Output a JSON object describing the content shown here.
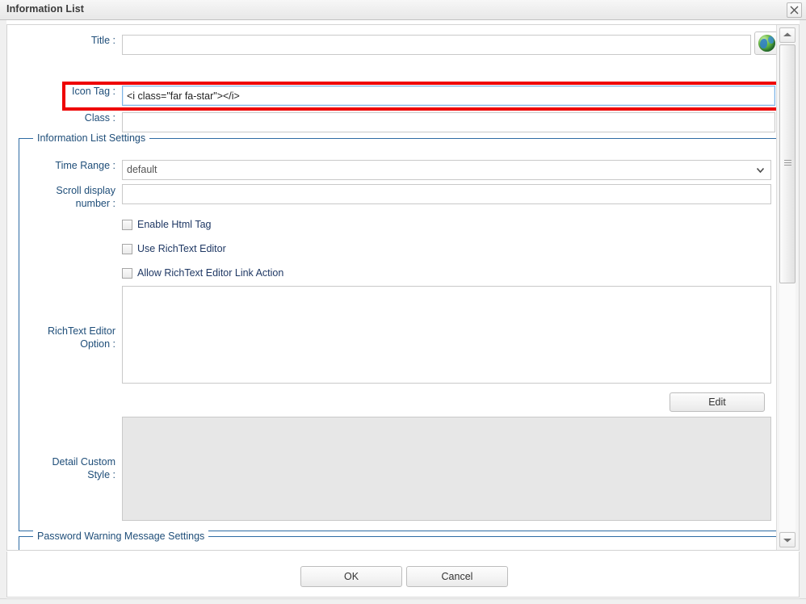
{
  "window": {
    "title": "Information List",
    "close_icon": "close-icon"
  },
  "form": {
    "title": {
      "label": "Title :",
      "value": "",
      "placeholder": ""
    },
    "icon_tag": {
      "label": "Icon Tag :",
      "value": "<i class=\"far fa-star\"></i>",
      "placeholder": "",
      "highlight_color": "#ee0000"
    },
    "class": {
      "label": "Class :",
      "value": "",
      "placeholder": ""
    },
    "globe_button": {
      "icon": "globe-icon"
    }
  },
  "settings_fieldset": {
    "legend": "Information List Settings",
    "time_range": {
      "label": "Time Range :",
      "selected": "default",
      "caret_icon": "chevron-down-icon"
    },
    "scroll_display_number": {
      "label": "Scroll display\nnumber :",
      "value": "",
      "placeholder": ""
    },
    "checkboxes": [
      {
        "label": "Enable Html Tag",
        "checked": false
      },
      {
        "label": "Use RichText Editor",
        "checked": false
      },
      {
        "label": "Allow RichText Editor Link Action",
        "checked": false
      }
    ],
    "richtext_editor_option": {
      "label": "RichText Editor\nOption :",
      "value": ""
    },
    "edit_button": {
      "label": "Edit"
    },
    "detail_custom_style": {
      "label": "Detail Custom\nStyle :",
      "value": "",
      "readonly": true
    }
  },
  "password_fieldset": {
    "legend": "Password Warning Message Settings"
  },
  "scrollbar": {
    "up_icon": "scroll-up-arrow-icon",
    "down_icon": "scroll-down-arrow-icon"
  },
  "footer": {
    "ok_label": "OK",
    "cancel_label": "Cancel"
  },
  "colors": {
    "label_text": "#1f4e79",
    "fieldset_border": "#2e6ca4",
    "highlight": "#ee0000",
    "focus_border": "#7db4e6",
    "readonly_bg": "#e7e7e7"
  }
}
